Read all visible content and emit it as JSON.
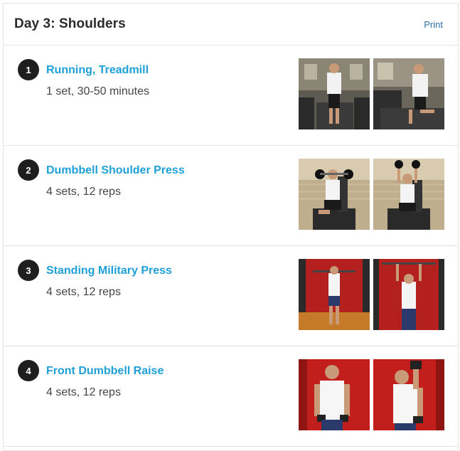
{
  "header": {
    "title": "Day 3: Shoulders",
    "print_label": "Print"
  },
  "exercises": [
    {
      "number": "1",
      "name": "Running, Treadmill",
      "detail": "1 set, 30-50 minutes"
    },
    {
      "number": "2",
      "name": "Dumbbell Shoulder Press",
      "detail": "4 sets, 12 reps"
    },
    {
      "number": "3",
      "name": "Standing Military Press",
      "detail": "4 sets, 12 reps"
    },
    {
      "number": "4",
      "name": "Front Dumbbell Raise",
      "detail": "4 sets, 12 reps"
    }
  ],
  "colors": {
    "link": "#1fa0d8",
    "badge": "#1e1e1e",
    "print": "#2c6fa8"
  }
}
